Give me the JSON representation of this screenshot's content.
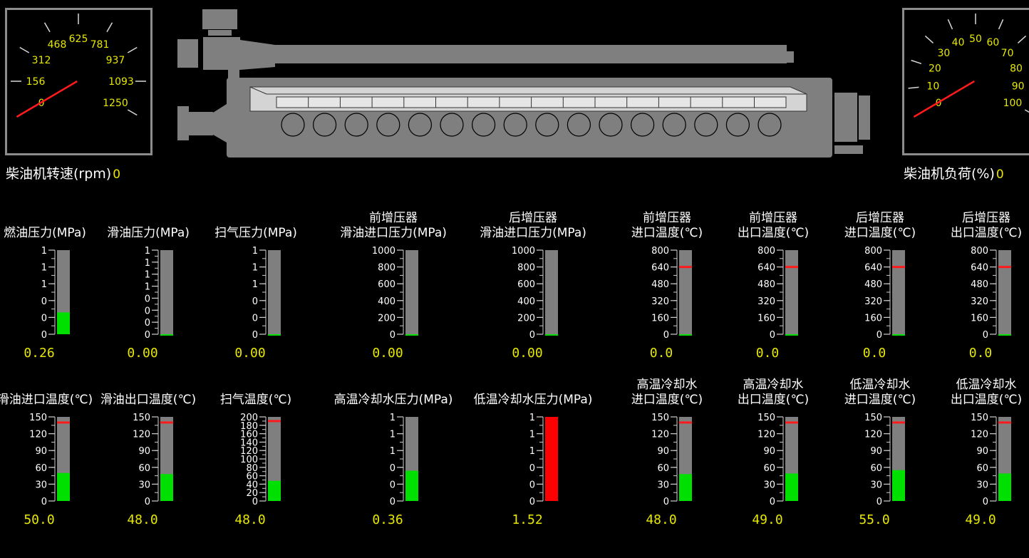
{
  "colors": {
    "background": "#000000",
    "frame": "#8c8c8c",
    "engine": "#7f7f7f",
    "value_text": "#e7e700",
    "needle": "#ff1b1b",
    "fill_ok": "#00e000",
    "fill_alarm": "#ff0000",
    "limit_mark": "#ff1b1b"
  },
  "rpm_dial": {
    "tick_labels": [
      "0",
      "156",
      "312",
      "468",
      "625",
      "781",
      "937",
      "1093",
      "1250"
    ],
    "label": "柴油机转速(rpm)",
    "value": "0"
  },
  "load_dial": {
    "tick_labels": [
      "0",
      "10",
      "20",
      "30",
      "40",
      "50",
      "60",
      "70",
      "80",
      "90",
      "100"
    ],
    "label": "柴油机负荷(%)",
    "value": "0"
  },
  "engine": {
    "cylinder_count": 16
  },
  "gauges_row1": [
    {
      "title": [
        "",
        "燃油压力(MPa)"
      ],
      "ticks": [
        "0",
        "0",
        "0",
        "1",
        "1",
        "1"
      ],
      "value": "0.26",
      "level": 0.26,
      "fill": "ok",
      "limit": null
    },
    {
      "title": [
        "",
        "滑油压力(MPa)"
      ],
      "ticks": [
        "0",
        "0",
        "0",
        "0",
        "1",
        "1",
        "1",
        "1"
      ],
      "value": "0.00",
      "level": 0.0,
      "fill": "ok",
      "limit": null
    },
    {
      "title": [
        "",
        "扫气压力(MPa)"
      ],
      "ticks": [
        "0",
        "0",
        "0",
        "1",
        "1",
        "1"
      ],
      "value": "0.00",
      "level": 0.0,
      "fill": "ok",
      "limit": null
    },
    {
      "title": [
        "前增压器",
        "滑油进口压力(MPa)"
      ],
      "ticks": [
        "0",
        "200",
        "400",
        "600",
        "800",
        "1000"
      ],
      "value": "0.00",
      "level": 0.0,
      "fill": "ok",
      "limit": null
    },
    {
      "title": [
        "后增压器",
        "滑油进口压力(MPa)"
      ],
      "ticks": [
        "0",
        "200",
        "400",
        "600",
        "800",
        "1000"
      ],
      "value": "0.00",
      "level": 0.0,
      "fill": "ok",
      "limit": null
    },
    {
      "title": [
        "前增压器",
        "进口温度(℃)"
      ],
      "ticks": [
        "0",
        "160",
        "320",
        "480",
        "640",
        "800"
      ],
      "value": "0.0",
      "level": 0.0,
      "fill": "ok",
      "limit": 0.8
    },
    {
      "title": [
        "前增压器",
        "出口温度(℃)"
      ],
      "ticks": [
        "0",
        "160",
        "320",
        "480",
        "640",
        "800"
      ],
      "value": "0.0",
      "level": 0.0,
      "fill": "ok",
      "limit": 0.8
    },
    {
      "title": [
        "后增压器",
        "进口温度(℃)"
      ],
      "ticks": [
        "0",
        "160",
        "320",
        "480",
        "640",
        "800"
      ],
      "value": "0.0",
      "level": 0.0,
      "fill": "ok",
      "limit": 0.8
    },
    {
      "title": [
        "后增压器",
        "出口温度(℃)"
      ],
      "ticks": [
        "0",
        "160",
        "320",
        "480",
        "640",
        "800"
      ],
      "value": "0.0",
      "level": 0.0,
      "fill": "ok",
      "limit": 0.8
    }
  ],
  "gauges_row2": [
    {
      "title": [
        "",
        "滑油进口温度(℃)"
      ],
      "ticks": [
        "0",
        "30",
        "60",
        "90",
        "120",
        "150"
      ],
      "value": "50.0",
      "level": 0.333,
      "fill": "ok",
      "limit": 0.933
    },
    {
      "title": [
        "",
        "滑油出口温度(℃)"
      ],
      "ticks": [
        "0",
        "30",
        "60",
        "90",
        "120",
        "150"
      ],
      "value": "48.0",
      "level": 0.32,
      "fill": "ok",
      "limit": 0.933
    },
    {
      "title": [
        "",
        "扫气温度(℃)"
      ],
      "ticks": [
        "0",
        "20",
        "40",
        "60",
        "80",
        "100",
        "120",
        "140",
        "160",
        "180",
        "200"
      ],
      "value": "48.0",
      "level": 0.24,
      "fill": "ok",
      "limit": 0.95
    },
    {
      "title": [
        "",
        "高温冷却水压力(MPa)"
      ],
      "ticks": [
        "0",
        "0",
        "0",
        "1",
        "1",
        "1"
      ],
      "value": "0.36",
      "level": 0.36,
      "fill": "ok",
      "limit": null
    },
    {
      "title": [
        "",
        "低温冷却水压力(MPa)"
      ],
      "ticks": [
        "0",
        "0",
        "0",
        "1",
        "1",
        "1"
      ],
      "value": "1.52",
      "level": 1.0,
      "fill": "alarm",
      "limit": null
    },
    {
      "title": [
        "高温冷却水",
        "进口温度(℃)"
      ],
      "ticks": [
        "0",
        "30",
        "60",
        "90",
        "120",
        "150"
      ],
      "value": "48.0",
      "level": 0.32,
      "fill": "ok",
      "limit": 0.933
    },
    {
      "title": [
        "高温冷却水",
        "出口温度(℃)"
      ],
      "ticks": [
        "0",
        "30",
        "60",
        "90",
        "120",
        "150"
      ],
      "value": "49.0",
      "level": 0.327,
      "fill": "ok",
      "limit": 0.933
    },
    {
      "title": [
        "低温冷却水",
        "进口温度(℃)"
      ],
      "ticks": [
        "0",
        "30",
        "60",
        "90",
        "120",
        "150"
      ],
      "value": "55.0",
      "level": 0.367,
      "fill": "ok",
      "limit": 0.933
    },
    {
      "title": [
        "低温冷却水",
        "出口温度(℃)"
      ],
      "ticks": [
        "0",
        "30",
        "60",
        "90",
        "120",
        "150"
      ],
      "value": "49.0",
      "level": 0.327,
      "fill": "ok",
      "limit": 0.933
    }
  ]
}
